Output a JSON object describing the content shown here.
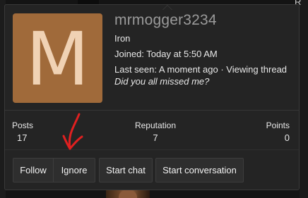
{
  "backdrop": {
    "right_edge_text": "R"
  },
  "member_card": {
    "avatar_letter": "M",
    "avatar_color": "#a06a3a",
    "username": "mrmogger3234",
    "rank": "Iron",
    "joined": "Joined: Today at 5:50 AM",
    "last_seen": "Last seen: A moment ago · Viewing thread",
    "custom_title": "Did you all missed me?",
    "stats": {
      "posts_label": "Posts",
      "posts_value": "17",
      "reputation_label": "Reputation",
      "reputation_value": "7",
      "points_label": "Points",
      "points_value": "0"
    },
    "actions": {
      "follow": "Follow",
      "ignore": "Ignore",
      "start_chat": "Start chat",
      "start_conversation": "Start conversation"
    }
  },
  "annotation": {
    "type": "hand-drawn-arrow",
    "color": "#e02020",
    "points_to": "ignore-button"
  }
}
